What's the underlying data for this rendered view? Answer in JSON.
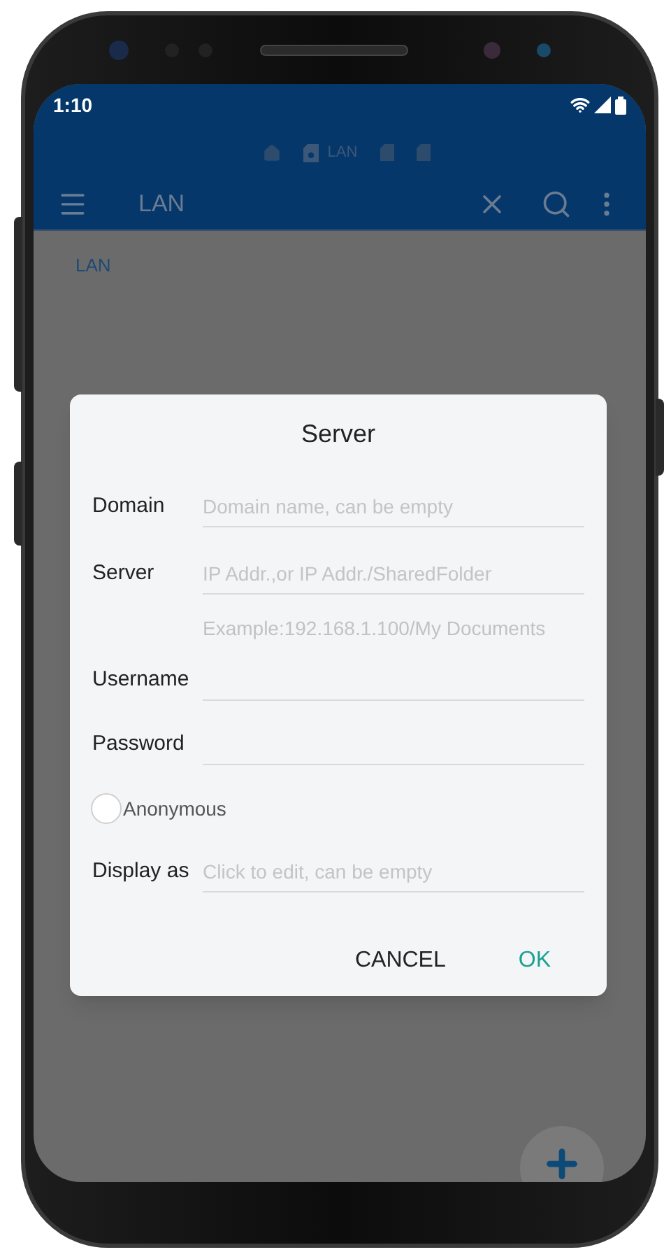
{
  "status_bar": {
    "time": "1:10"
  },
  "breadcrumb": {
    "label": "LAN"
  },
  "toolbar": {
    "title": "LAN"
  },
  "path_label": "LAN",
  "dialog": {
    "title": "Server",
    "rows": [
      {
        "kind": "input",
        "label": "Domain",
        "placeholder": "Domain name, can be empty"
      },
      {
        "kind": "input",
        "label": "Server",
        "placeholder": "IP Addr.,or IP Addr./SharedFolder"
      },
      {
        "kind": "hint",
        "text": "Example:192.168.1.100/My Documents"
      },
      {
        "kind": "input",
        "label": "Username"
      },
      {
        "kind": "input",
        "label": "Password"
      },
      {
        "kind": "radio",
        "label": "Anonymous",
        "checked": false
      },
      {
        "kind": "input",
        "label": "Display as",
        "placeholder": "Click to edit, can be empty"
      }
    ],
    "buttons": [
      {
        "label": "CANCEL",
        "kind": "neutral"
      },
      {
        "label": "OK",
        "kind": "primary"
      }
    ]
  }
}
